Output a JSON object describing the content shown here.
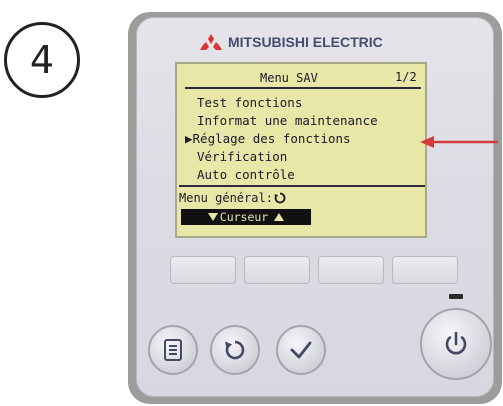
{
  "step": {
    "number": "4"
  },
  "device": {
    "brand": "MITSUBISHI ELECTRIC",
    "colors": {
      "lcd": "#e9e7a8",
      "brand_text": "#454c6e",
      "arrow": "#d63a3a"
    }
  },
  "lcd": {
    "title": "Menu SAV",
    "page": "1/2",
    "items": [
      {
        "label": "Test fonctions"
      },
      {
        "label": "Informat une maintenance"
      },
      {
        "label": "▶Réglage des fonctions"
      },
      {
        "label": "Vérification"
      },
      {
        "label": "Auto contrôle"
      }
    ],
    "nav_label": "Menu général:",
    "cursor_label": "Curseur"
  },
  "buttons": [
    {
      "icon": "menu-icon"
    },
    {
      "icon": "return-icon"
    },
    {
      "icon": "check-icon"
    },
    {
      "icon": "power-icon"
    }
  ]
}
